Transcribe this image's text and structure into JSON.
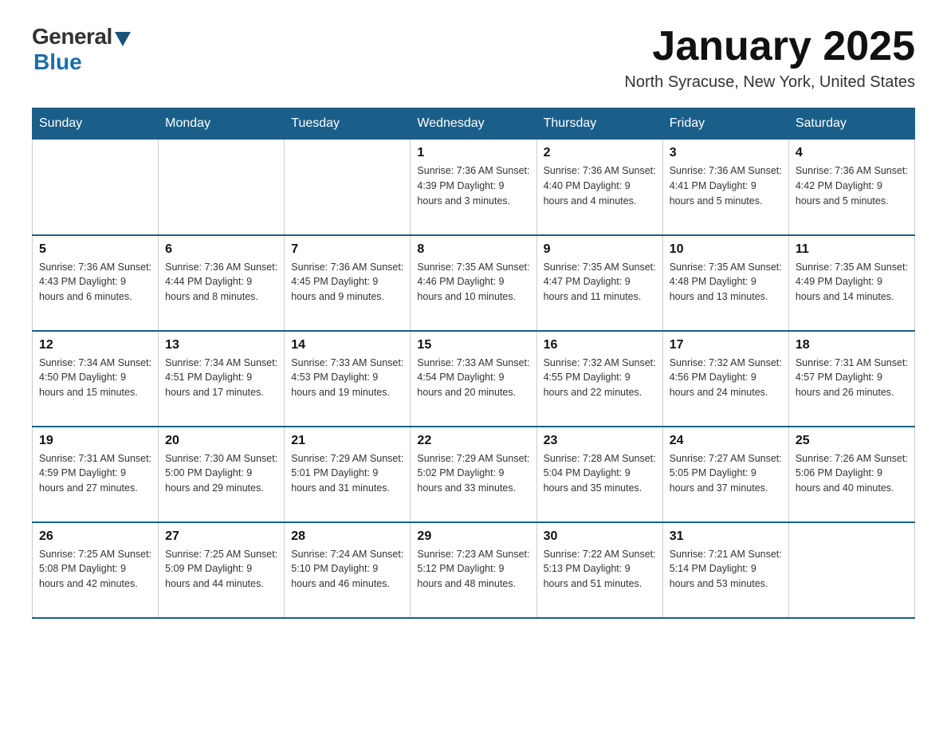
{
  "logo": {
    "general": "General",
    "blue": "Blue"
  },
  "title": {
    "month_year": "January 2025",
    "location": "North Syracuse, New York, United States"
  },
  "days_of_week": [
    "Sunday",
    "Monday",
    "Tuesday",
    "Wednesday",
    "Thursday",
    "Friday",
    "Saturday"
  ],
  "weeks": [
    [
      {
        "num": "",
        "info": ""
      },
      {
        "num": "",
        "info": ""
      },
      {
        "num": "",
        "info": ""
      },
      {
        "num": "1",
        "info": "Sunrise: 7:36 AM\nSunset: 4:39 PM\nDaylight: 9 hours and 3 minutes."
      },
      {
        "num": "2",
        "info": "Sunrise: 7:36 AM\nSunset: 4:40 PM\nDaylight: 9 hours and 4 minutes."
      },
      {
        "num": "3",
        "info": "Sunrise: 7:36 AM\nSunset: 4:41 PM\nDaylight: 9 hours and 5 minutes."
      },
      {
        "num": "4",
        "info": "Sunrise: 7:36 AM\nSunset: 4:42 PM\nDaylight: 9 hours and 5 minutes."
      }
    ],
    [
      {
        "num": "5",
        "info": "Sunrise: 7:36 AM\nSunset: 4:43 PM\nDaylight: 9 hours and 6 minutes."
      },
      {
        "num": "6",
        "info": "Sunrise: 7:36 AM\nSunset: 4:44 PM\nDaylight: 9 hours and 8 minutes."
      },
      {
        "num": "7",
        "info": "Sunrise: 7:36 AM\nSunset: 4:45 PM\nDaylight: 9 hours and 9 minutes."
      },
      {
        "num": "8",
        "info": "Sunrise: 7:35 AM\nSunset: 4:46 PM\nDaylight: 9 hours and 10 minutes."
      },
      {
        "num": "9",
        "info": "Sunrise: 7:35 AM\nSunset: 4:47 PM\nDaylight: 9 hours and 11 minutes."
      },
      {
        "num": "10",
        "info": "Sunrise: 7:35 AM\nSunset: 4:48 PM\nDaylight: 9 hours and 13 minutes."
      },
      {
        "num": "11",
        "info": "Sunrise: 7:35 AM\nSunset: 4:49 PM\nDaylight: 9 hours and 14 minutes."
      }
    ],
    [
      {
        "num": "12",
        "info": "Sunrise: 7:34 AM\nSunset: 4:50 PM\nDaylight: 9 hours and 15 minutes."
      },
      {
        "num": "13",
        "info": "Sunrise: 7:34 AM\nSunset: 4:51 PM\nDaylight: 9 hours and 17 minutes."
      },
      {
        "num": "14",
        "info": "Sunrise: 7:33 AM\nSunset: 4:53 PM\nDaylight: 9 hours and 19 minutes."
      },
      {
        "num": "15",
        "info": "Sunrise: 7:33 AM\nSunset: 4:54 PM\nDaylight: 9 hours and 20 minutes."
      },
      {
        "num": "16",
        "info": "Sunrise: 7:32 AM\nSunset: 4:55 PM\nDaylight: 9 hours and 22 minutes."
      },
      {
        "num": "17",
        "info": "Sunrise: 7:32 AM\nSunset: 4:56 PM\nDaylight: 9 hours and 24 minutes."
      },
      {
        "num": "18",
        "info": "Sunrise: 7:31 AM\nSunset: 4:57 PM\nDaylight: 9 hours and 26 minutes."
      }
    ],
    [
      {
        "num": "19",
        "info": "Sunrise: 7:31 AM\nSunset: 4:59 PM\nDaylight: 9 hours and 27 minutes."
      },
      {
        "num": "20",
        "info": "Sunrise: 7:30 AM\nSunset: 5:00 PM\nDaylight: 9 hours and 29 minutes."
      },
      {
        "num": "21",
        "info": "Sunrise: 7:29 AM\nSunset: 5:01 PM\nDaylight: 9 hours and 31 minutes."
      },
      {
        "num": "22",
        "info": "Sunrise: 7:29 AM\nSunset: 5:02 PM\nDaylight: 9 hours and 33 minutes."
      },
      {
        "num": "23",
        "info": "Sunrise: 7:28 AM\nSunset: 5:04 PM\nDaylight: 9 hours and 35 minutes."
      },
      {
        "num": "24",
        "info": "Sunrise: 7:27 AM\nSunset: 5:05 PM\nDaylight: 9 hours and 37 minutes."
      },
      {
        "num": "25",
        "info": "Sunrise: 7:26 AM\nSunset: 5:06 PM\nDaylight: 9 hours and 40 minutes."
      }
    ],
    [
      {
        "num": "26",
        "info": "Sunrise: 7:25 AM\nSunset: 5:08 PM\nDaylight: 9 hours and 42 minutes."
      },
      {
        "num": "27",
        "info": "Sunrise: 7:25 AM\nSunset: 5:09 PM\nDaylight: 9 hours and 44 minutes."
      },
      {
        "num": "28",
        "info": "Sunrise: 7:24 AM\nSunset: 5:10 PM\nDaylight: 9 hours and 46 minutes."
      },
      {
        "num": "29",
        "info": "Sunrise: 7:23 AM\nSunset: 5:12 PM\nDaylight: 9 hours and 48 minutes."
      },
      {
        "num": "30",
        "info": "Sunrise: 7:22 AM\nSunset: 5:13 PM\nDaylight: 9 hours and 51 minutes."
      },
      {
        "num": "31",
        "info": "Sunrise: 7:21 AM\nSunset: 5:14 PM\nDaylight: 9 hours and 53 minutes."
      },
      {
        "num": "",
        "info": ""
      }
    ]
  ]
}
